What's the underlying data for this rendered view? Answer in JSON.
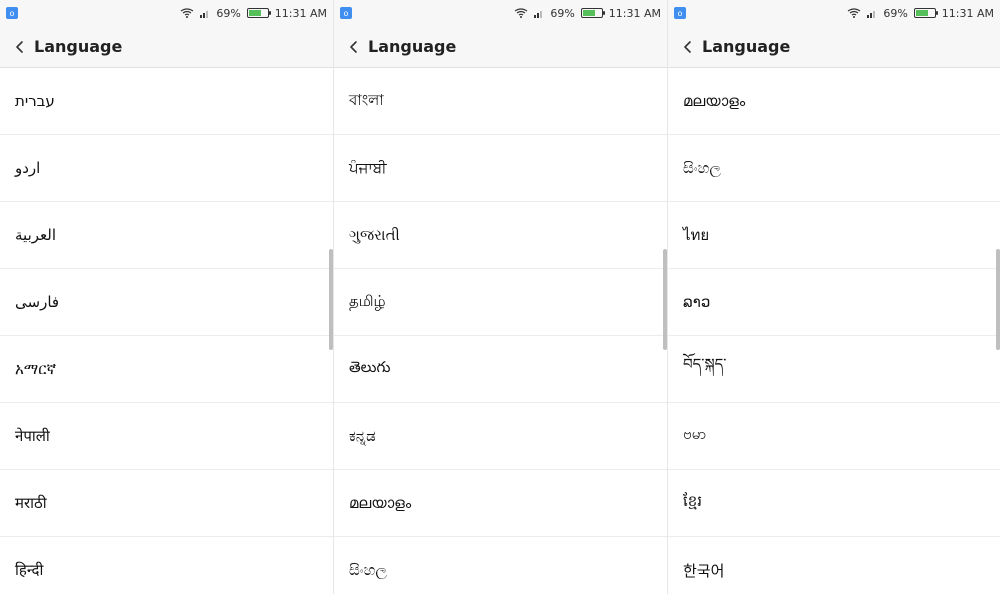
{
  "status_bar": {
    "battery_percent": "69%",
    "time": "11:31 AM",
    "battery_level": 0.69
  },
  "colors": {
    "accent_notification": "#3f8ef0",
    "battery_green": "#55c05a",
    "scroll_thumb": "#bfbfbf"
  },
  "icons": [
    "notification-icon",
    "wifi-icon",
    "signal-icon",
    "battery-icon",
    "back-arrow-icon"
  ],
  "panels": [
    {
      "title": "Language",
      "items": [
        "עברית",
        "اردو",
        "العربية",
        "فارسی",
        "አማርኛ",
        "नेपाली",
        "मराठी",
        "हिन्दी"
      ],
      "scroll": {
        "top_fraction": 0.42,
        "height_fraction": 0.17
      }
    },
    {
      "title": "Language",
      "items": [
        "বাংলা",
        "ਪੰਜਾਬੀ",
        "ગુજરાતી",
        "தமிழ்",
        "తెలుగు",
        "ಕನ್ನಡ",
        "മലയാളം",
        "සිංහල"
      ],
      "scroll": {
        "top_fraction": 0.42,
        "height_fraction": 0.17
      }
    },
    {
      "title": "Language",
      "items": [
        "മലയാളം",
        "සිංහල",
        "ไทย",
        "ລາວ",
        "བོད་སྐད་",
        "ဗမာ",
        "ខ្មែរ",
        "한국어"
      ],
      "scroll": {
        "top_fraction": 0.42,
        "height_fraction": 0.17
      }
    }
  ]
}
